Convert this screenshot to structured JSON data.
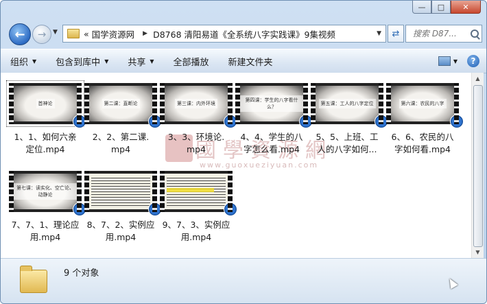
{
  "window": {
    "minimize_glyph": "—",
    "maximize_glyph": "□",
    "close_glyph": "✕"
  },
  "nav": {
    "back_glyph": "←",
    "forward_glyph": "→",
    "address": {
      "prefix": "«",
      "segments": [
        "国学资源网",
        "D8768 清阳易道《全系统八字实践课》9集视频"
      ]
    },
    "search_placeholder": "搜索 D87..."
  },
  "toolbar": {
    "organize": "组织",
    "include_in_library": "包含到库中",
    "share": "共享",
    "play_all": "全部播放",
    "new_folder": "新建文件夹"
  },
  "files": [
    {
      "name_line1": "1、1、如何六亲",
      "name_line2": "定位.mp4",
      "frame": "首神论",
      "style": "video"
    },
    {
      "name_line1": "2、2、第二课.",
      "name_line2": "mp4",
      "frame": "第二课：直断论",
      "style": "video"
    },
    {
      "name_line1": "3、3、环境论.",
      "name_line2": "mp4",
      "frame": "第三课：内外环境",
      "style": "video"
    },
    {
      "name_line1": "4、4、学生的八",
      "name_line2": "字怎么看.mp4",
      "frame": "第四课：学生的八字看什么？",
      "style": "video"
    },
    {
      "name_line1": "5、5、上班、工",
      "name_line2": "人的八字如何...",
      "frame": "第五课：工人的八字定位",
      "style": "video"
    },
    {
      "name_line1": "6、6、农民的八",
      "name_line2": "字如何看.mp4",
      "frame": "第六课：农民的八字",
      "style": "video"
    },
    {
      "name_line1": "7、7、1、理论应",
      "name_line2": "用.mp4",
      "frame": "第七课：读实化、空亡论、动静论",
      "style": "video"
    },
    {
      "name_line1": "8、7、2、实例应",
      "name_line2": "用.mp4",
      "frame": "",
      "style": "text"
    },
    {
      "name_line1": "9、7、3、实例应",
      "name_line2": "用.mp4",
      "frame": "",
      "style": "text-hl"
    }
  ],
  "watermark": {
    "text": "國學資源網",
    "url": "www.guoxueziyuan.com"
  },
  "status": {
    "count": "9 个对象"
  }
}
